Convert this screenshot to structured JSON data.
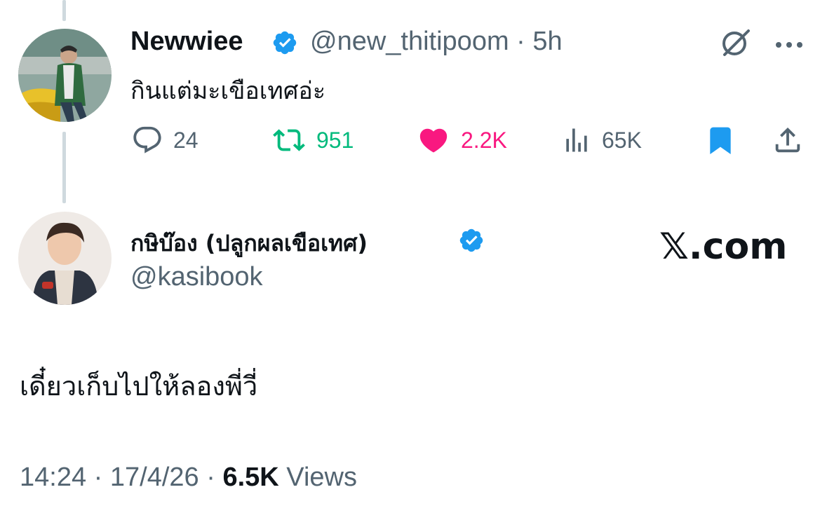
{
  "original_tweet": {
    "display_name": "Newwiee",
    "handle": "@new_thitipoom",
    "separator": "·",
    "time_ago": "5h",
    "text": "กินแต่มะเขือเทศอ่ะ",
    "actions": {
      "replies": "24",
      "retweets": "951",
      "likes": "2.2K",
      "views": "65K"
    },
    "icons": [
      "verified-badge-icon",
      "grok-icon",
      "more-icon",
      "reply-icon",
      "retweet-icon",
      "heart-icon",
      "views-icon",
      "bookmark-icon",
      "share-icon"
    ]
  },
  "reply_tweet": {
    "display_name": "กษิบ๊อง (ปลูกผลเขือเทศ)",
    "handle": "@kasibook",
    "text": "เดี๋ยวเก็บไปให้ลองพี่วี่",
    "brand": "𝕏.com",
    "footer": {
      "time": "14:24",
      "sep1": "·",
      "date": "17/4/26",
      "sep2": "·",
      "views_count": "6.5K",
      "views_label": "Views"
    }
  },
  "colors": {
    "text": "#0f1419",
    "secondary": "#536471",
    "verified": "#1d9bf0",
    "retweet_active": "#00ba7c",
    "like_active": "#f91880",
    "bookmark_active": "#1d9bf0",
    "thread_line": "#cfd9de"
  }
}
